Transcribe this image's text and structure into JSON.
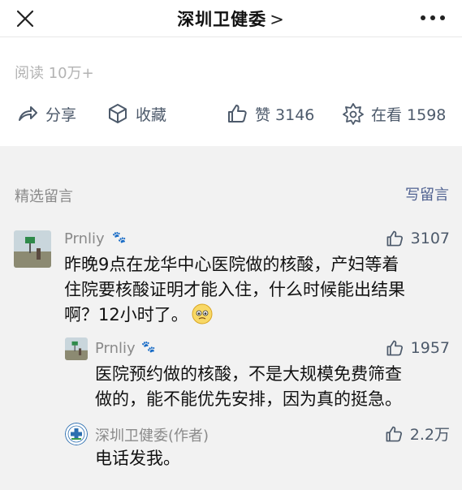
{
  "header": {
    "title": "深圳卫健委",
    "chevron": ">"
  },
  "read": {
    "text": "阅读 10万+"
  },
  "actions": {
    "share_label": "分享",
    "collect_label": "收藏",
    "like_label": "赞 3146",
    "watch_label": "在看 1598"
  },
  "comments_section": {
    "label": "精选留言",
    "write_label": "写留言"
  },
  "comments": [
    {
      "author": "Prnliy",
      "author_suffix": "🐾",
      "likes": "3107",
      "line1": "昨晚9点在龙华中心医院做的核酸，产妇等着",
      "line2": "住院要核酸证明才能入住，什么时候能出结果",
      "line3": "啊？12小时了。"
    },
    {
      "author": "Prnliy",
      "author_suffix": "🐾",
      "likes": "1957",
      "line1": "医院预约做的核酸，不是大规模免费筛查",
      "line2": "做的，能不能优先安排，因为真的挺急。"
    },
    {
      "author": "深圳卫健委(作者)",
      "likes": "2.2万",
      "line1": "电话发我。"
    }
  ],
  "colors": {
    "accent_link": "#4f6190",
    "icon_gray": "#4d5a6b",
    "muted": "#8a8a8a",
    "section_bg": "#f2f2f2"
  }
}
